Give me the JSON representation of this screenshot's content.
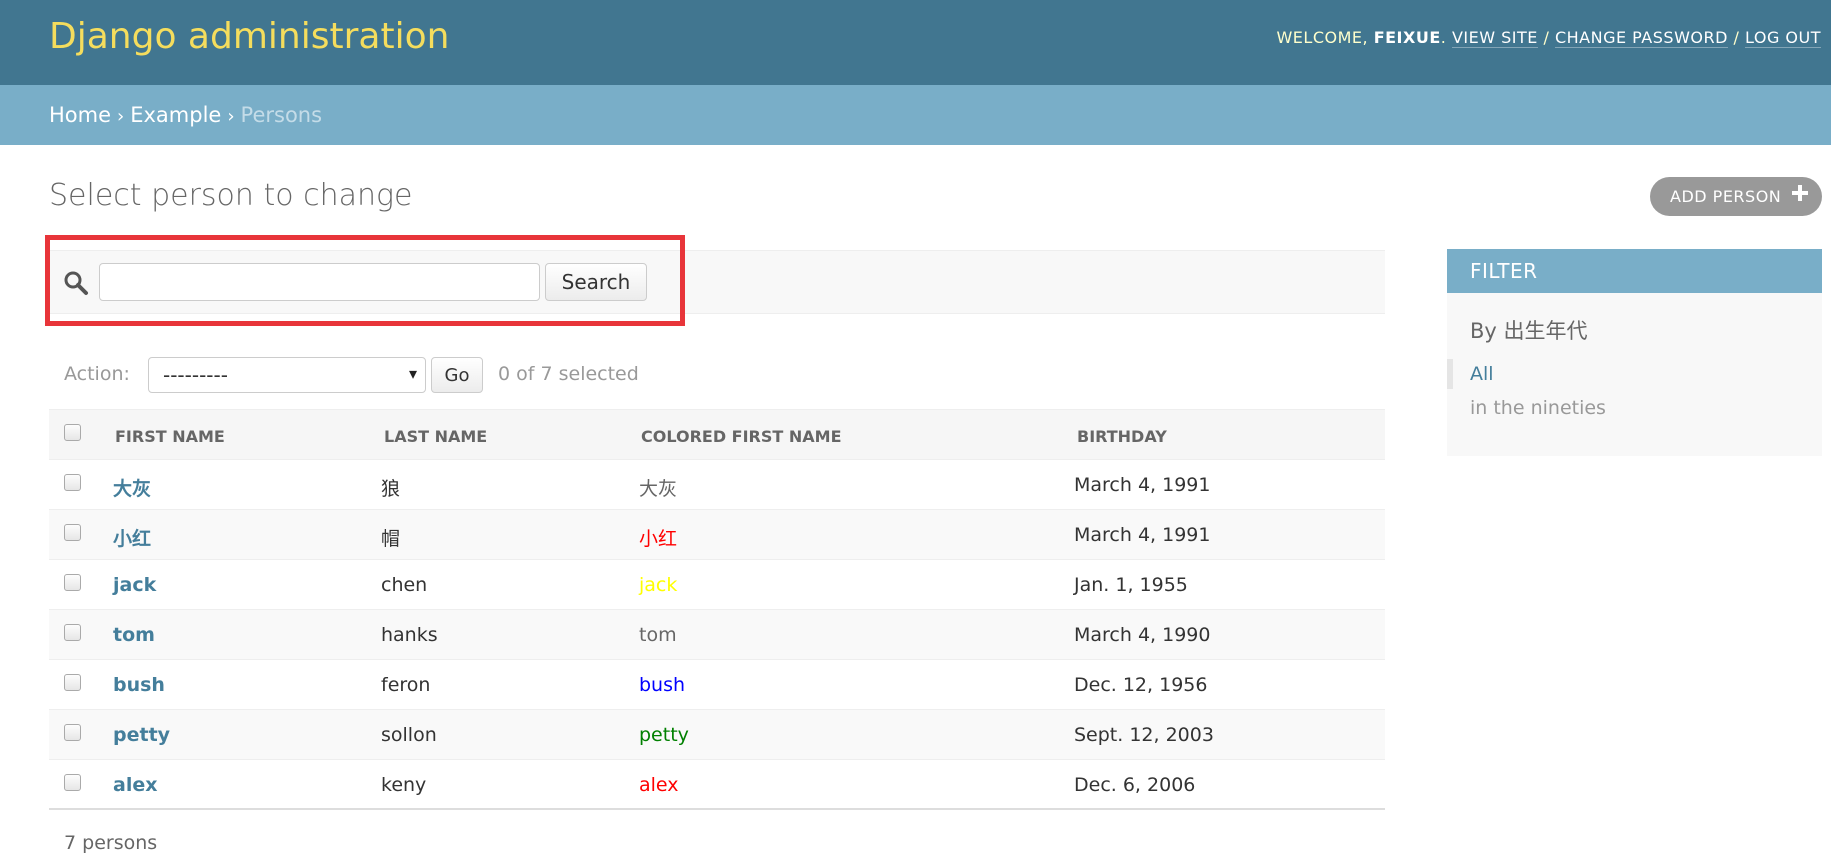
{
  "header": {
    "branding": "Django administration",
    "welcome_prefix": "WELCOME,",
    "username": "FEIXUE",
    "welcome_suffix": ".",
    "view_site": "VIEW SITE",
    "change_password": "CHANGE PASSWORD",
    "log_out": "LOG OUT",
    "sep": "/"
  },
  "breadcrumbs": {
    "home": "Home",
    "app": "Example",
    "current": "Persons",
    "sep": "›"
  },
  "page": {
    "title": "Select person to change",
    "add_button": "ADD PERSON"
  },
  "search": {
    "value": "",
    "button": "Search"
  },
  "actions": {
    "label": "Action:",
    "selected_option": "---------",
    "caret": "▾",
    "go": "Go",
    "selected_count": "0 of 7 selected"
  },
  "table": {
    "columns": [
      "FIRST NAME",
      "LAST NAME",
      "COLORED FIRST NAME",
      "BIRTHDAY"
    ],
    "rows": [
      {
        "first": "大灰",
        "last": "狼",
        "colored": "大灰",
        "color": "#666666",
        "birthday": "March 4, 1991"
      },
      {
        "first": "小红",
        "last": "帽",
        "colored": "小红",
        "color": "#ff0000",
        "birthday": "March 4, 1991"
      },
      {
        "first": "jack",
        "last": "chen",
        "colored": "jack",
        "color": "#ffff00",
        "birthday": "Jan. 1, 1955"
      },
      {
        "first": "tom",
        "last": "hanks",
        "colored": "tom",
        "color": "#666666",
        "birthday": "March 4, 1990"
      },
      {
        "first": "bush",
        "last": "feron",
        "colored": "bush",
        "color": "#0000ff",
        "birthday": "Dec. 12, 1956"
      },
      {
        "first": "petty",
        "last": "sollon",
        "colored": "petty",
        "color": "#008000",
        "birthday": "Sept. 12, 2003"
      },
      {
        "first": "alex",
        "last": "keny",
        "colored": "alex",
        "color": "#ff0000",
        "birthday": "Dec. 6, 2006"
      }
    ],
    "result_count": "7 persons"
  },
  "filter": {
    "title": "FILTER",
    "by": "By 出生年代",
    "options": [
      "All",
      "in the nineties"
    ]
  },
  "colors": {
    "header_bg": "#417690",
    "branding": "#f5dd5d",
    "breadcrumb_bg": "#79aec8",
    "link": "#447e9b",
    "highlight": "#e8353a"
  }
}
